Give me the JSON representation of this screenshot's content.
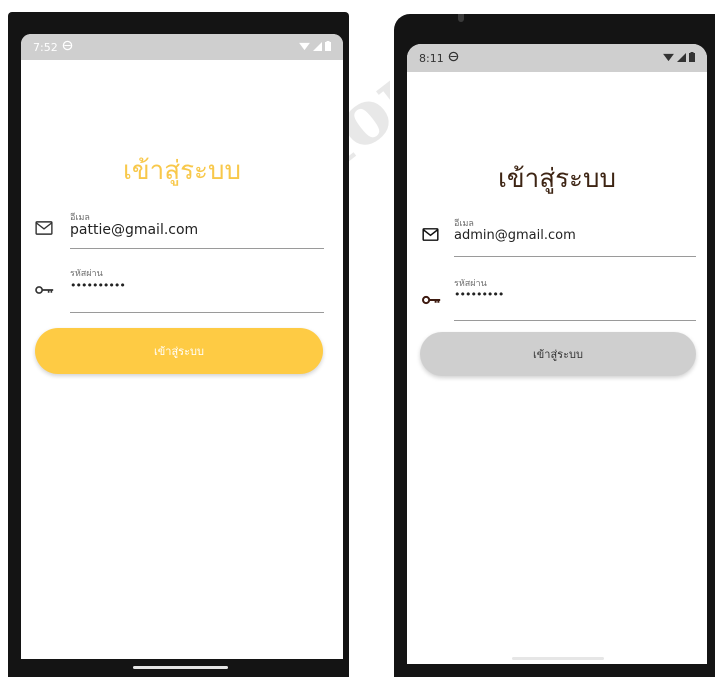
{
  "screens": [
    {
      "status_time": "7:52",
      "title": "เข้าสู่ระบบ",
      "email_label": "อีเมล",
      "email_value": "pattie@gmail.com",
      "password_label": "รหัสผ่าน",
      "password_value": "••••••••••",
      "login_label": "เข้าสู่ระบบ",
      "accent_color": "#fecb44"
    },
    {
      "status_time": "8:11",
      "title": "เข้าสู่ระบบ",
      "email_label": "อีเมล",
      "email_value": "admin@gmail.com",
      "password_label": "รหัสผ่าน",
      "password_value": "•••••••••",
      "login_label": "เข้าสู่ระบบ",
      "accent_color": "#cfcfcf"
    }
  ],
  "icons": {
    "email": "mail-icon",
    "password": "key-icon",
    "status": [
      "settings-icon",
      "wifi-icon",
      "signal-icon",
      "battery-icon"
    ]
  }
}
